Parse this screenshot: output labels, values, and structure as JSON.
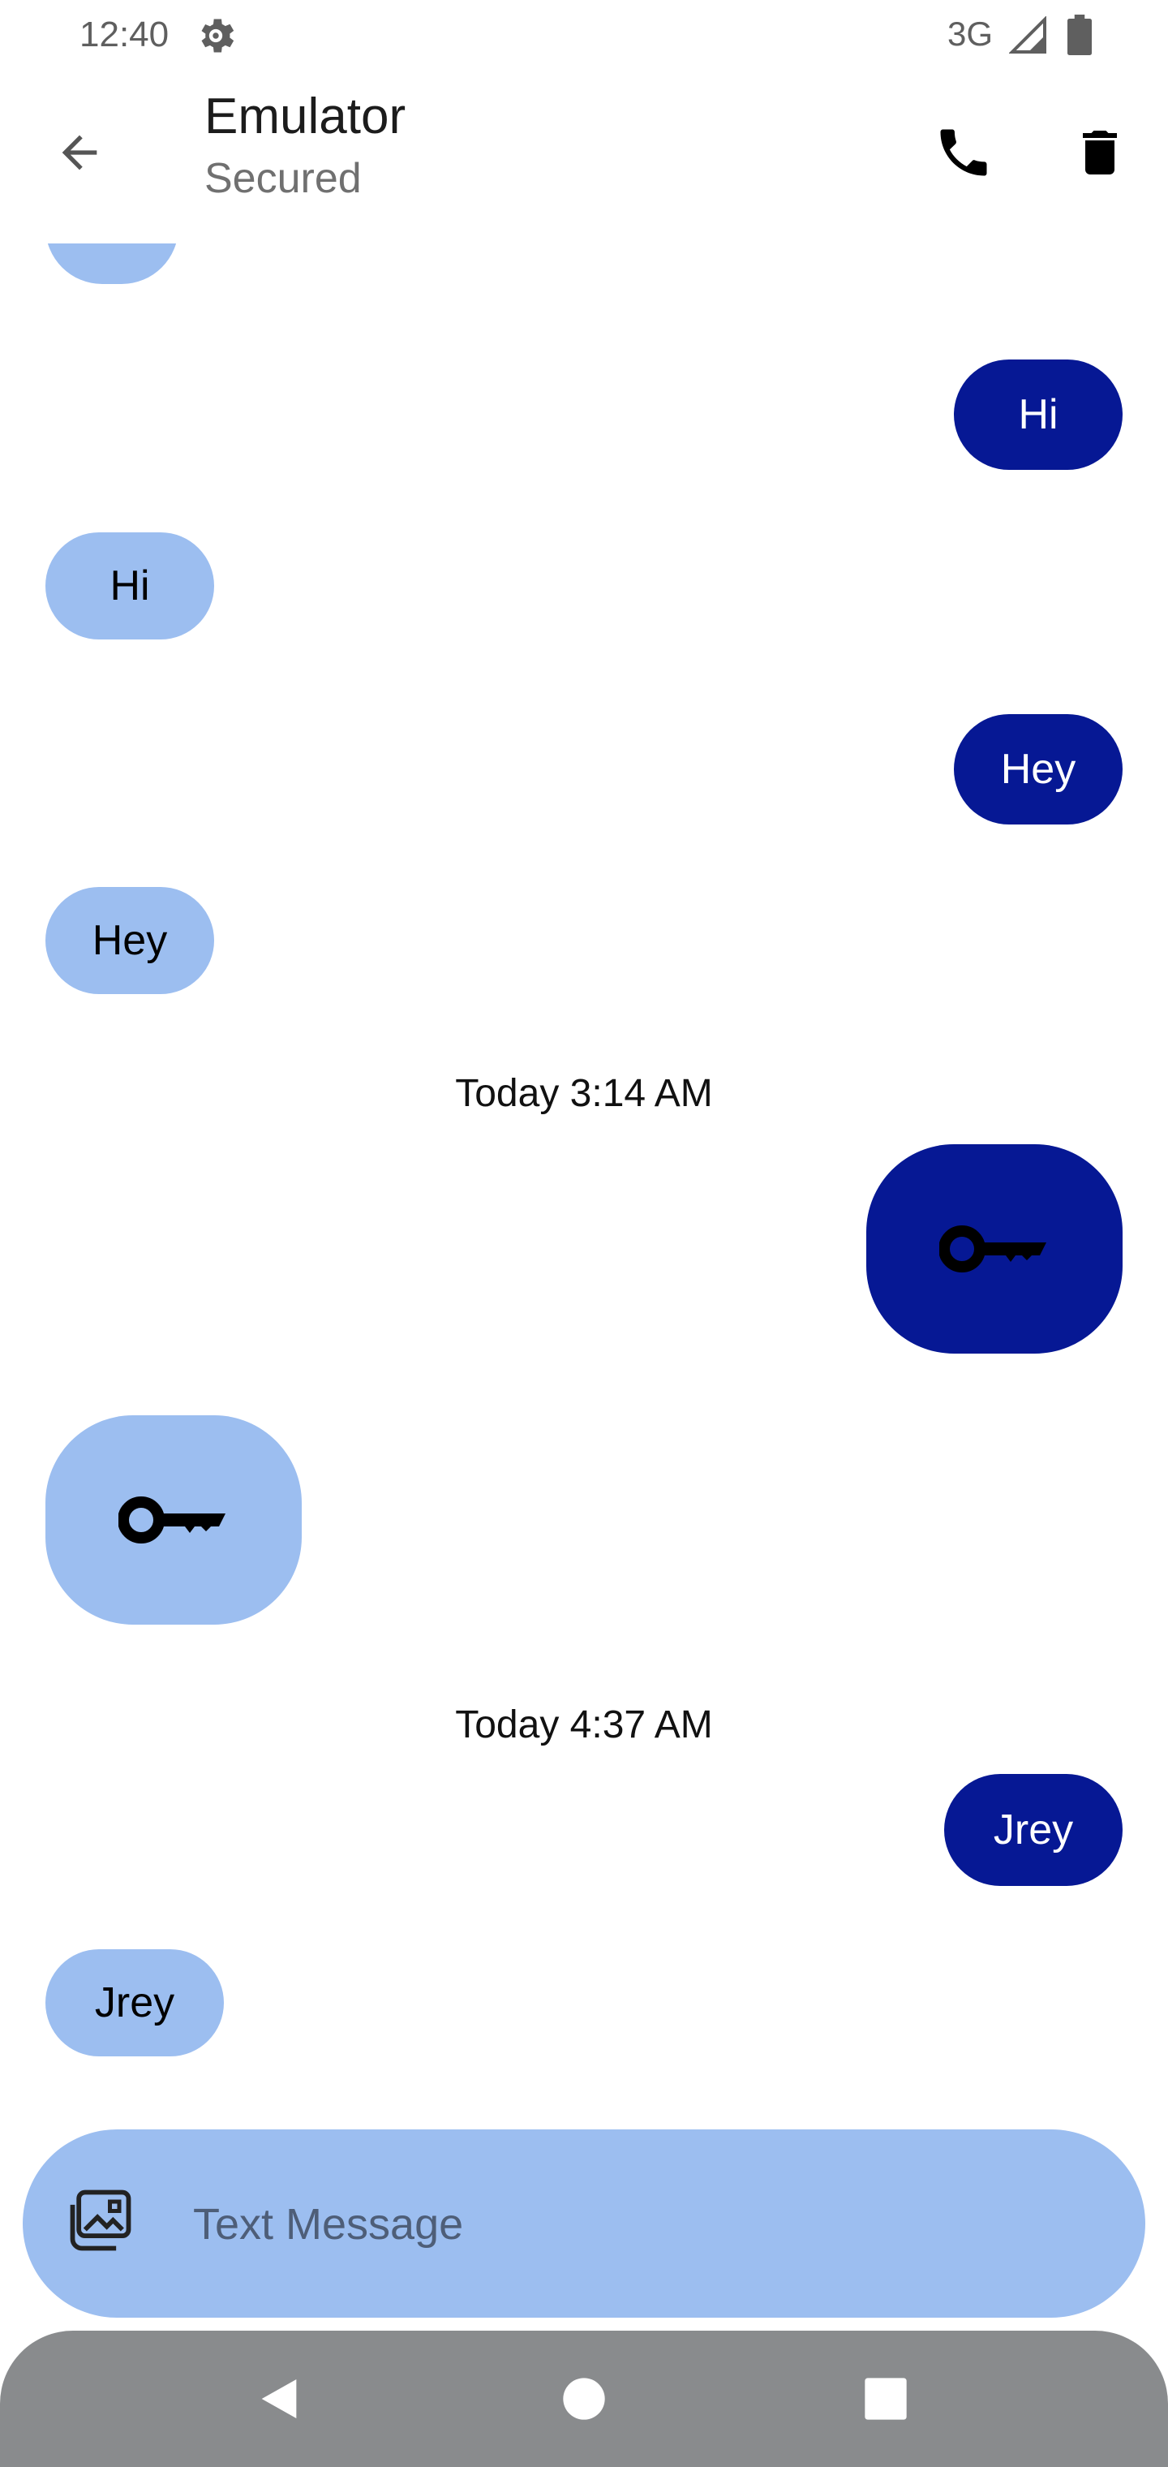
{
  "status_bar": {
    "time": "12:40",
    "network": "3G",
    "icons": [
      "gear-icon",
      "signal-icon",
      "battery-icon"
    ]
  },
  "app_bar": {
    "title": "Emulator",
    "subtitle": "Secured",
    "icons": [
      "back-arrow-icon",
      "phone-icon",
      "trash-icon"
    ]
  },
  "messages": [
    {
      "direction": "received",
      "text": "",
      "partial": true
    },
    {
      "direction": "sent",
      "text": "Hi"
    },
    {
      "direction": "received",
      "text": "Hi"
    },
    {
      "direction": "sent",
      "text": "Hey"
    },
    {
      "direction": "received",
      "text": "Hey"
    },
    {
      "timestamp": "Today 3:14 AM"
    },
    {
      "direction": "sent",
      "icon": "key-icon"
    },
    {
      "direction": "received",
      "icon": "key-icon"
    },
    {
      "timestamp": "Today 4:37 AM"
    },
    {
      "direction": "sent",
      "text": "Jrey"
    },
    {
      "direction": "received",
      "text": "Jrey"
    }
  ],
  "compose": {
    "placeholder": "Text Message",
    "value": "",
    "icon": "image-gallery-icon"
  },
  "nav_bar": {
    "icons": [
      "back-triangle-icon",
      "home-circle-icon",
      "recents-square-icon"
    ]
  },
  "colors": {
    "sent_bubble": "#061894",
    "received_bubble": "#9cbef0",
    "nav_bar": "#898b8d"
  }
}
